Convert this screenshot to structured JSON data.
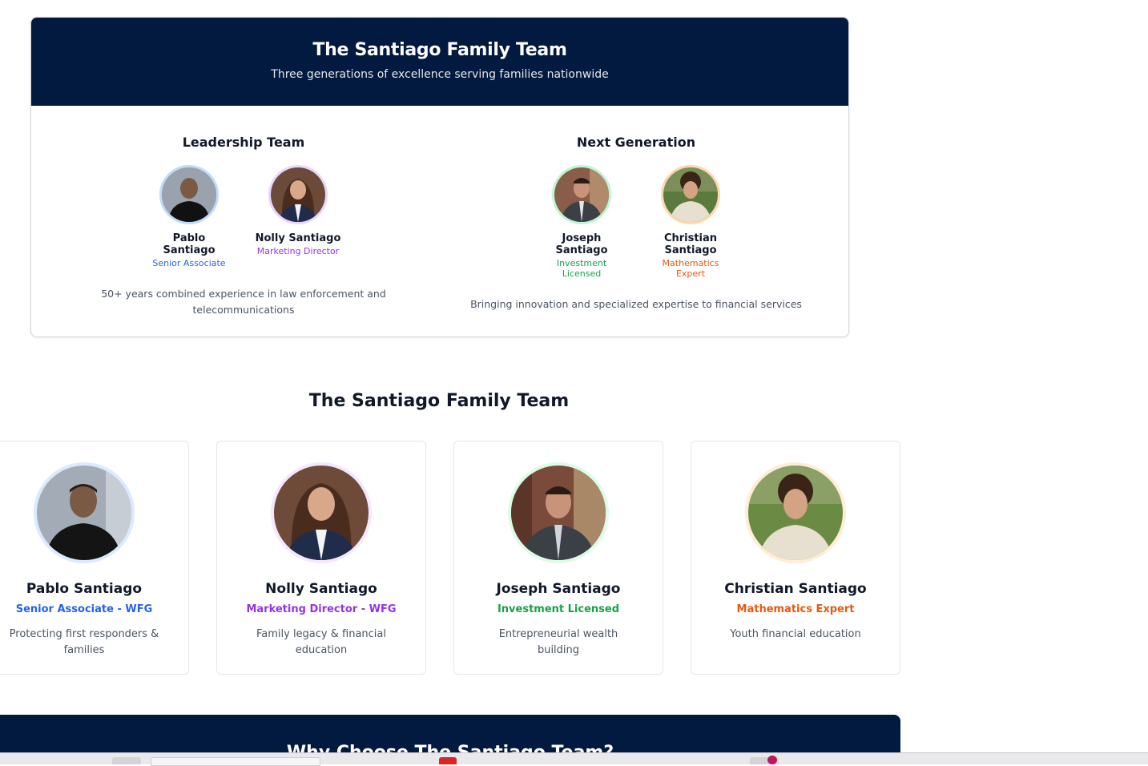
{
  "top_card": {
    "title": "The Santiago Family Team",
    "subtitle": "Three generations of excellence serving families nationwide",
    "leadership": {
      "heading": "Leadership Team",
      "people": [
        {
          "name": "Pablo Santiago",
          "role": "Senior Associate",
          "color": "#2563eb",
          "ring": "#bfdbfe"
        },
        {
          "name": "Nolly Santiago",
          "role": "Marketing Director",
          "color": "#9333ea",
          "ring": "#e9d5ff"
        }
      ],
      "description": "50+ years combined experience in law enforcement and telecommunications"
    },
    "next_gen": {
      "heading": "Next Generation",
      "people": [
        {
          "name": "Joseph Santiago",
          "role": "Investment Licensed",
          "color": "#16a34a",
          "ring": "#bbf7d0"
        },
        {
          "name": "Christian Santiago",
          "role": "Mathematics Expert",
          "color": "#ea580c",
          "ring": "#fed7aa"
        }
      ],
      "description": "Bringing innovation and specialized expertise to financial services"
    }
  },
  "team_section": {
    "title": "The Santiago Family Team",
    "cards": [
      {
        "name": "Pablo Santiago",
        "role": "Senior Associate - WFG",
        "desc": "Protecting first responders & families",
        "color": "#2563eb",
        "ring": "#dbeafe"
      },
      {
        "name": "Nolly Santiago",
        "role": "Marketing Director - WFG",
        "desc": "Family legacy & financial education",
        "color": "#9333ea",
        "ring": "#f3e8ff"
      },
      {
        "name": "Joseph Santiago",
        "role": "Investment Licensed",
        "desc": "Entrepreneurial wealth building",
        "color": "#16a34a",
        "ring": "#dcfce7"
      },
      {
        "name": "Christian Santiago",
        "role": "Mathematics Expert",
        "desc": "Youth financial education",
        "color": "#ea580c",
        "ring": "#ffedd5"
      }
    ]
  },
  "bottom_banner": {
    "title": "Why Choose The Santiago Team?"
  },
  "colors": {
    "navy": "#021a3f"
  }
}
